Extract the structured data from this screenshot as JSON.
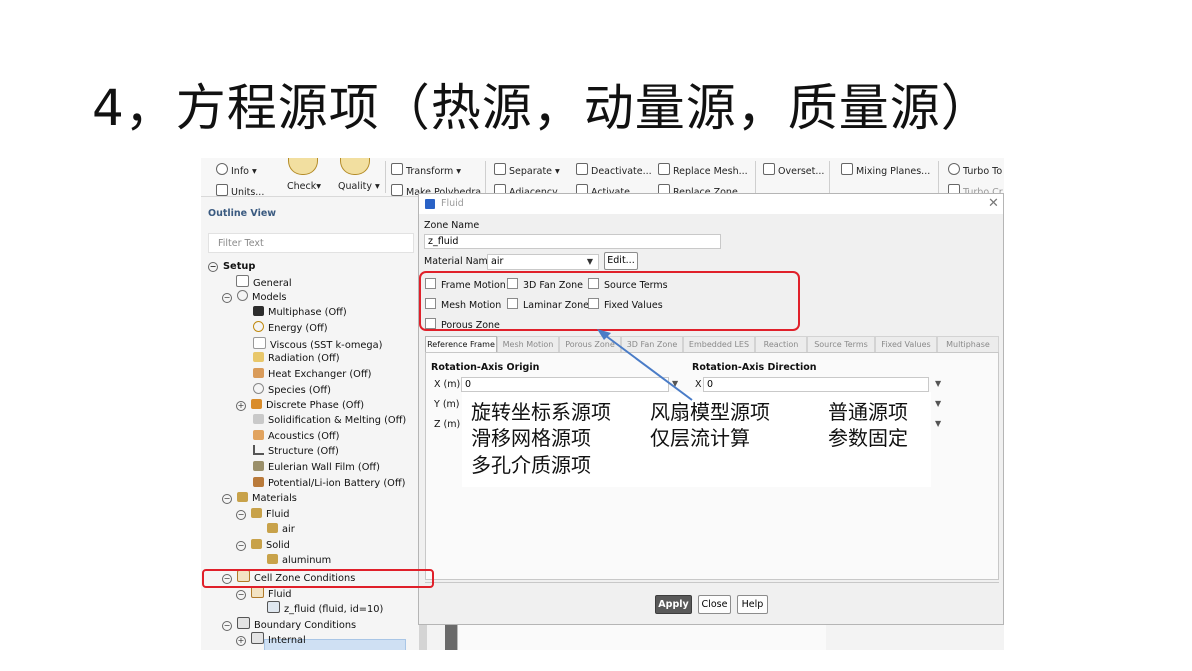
{
  "slide": {
    "title": "4，方程源项（热源，动量源，质量源）"
  },
  "ribbon": {
    "info": "Info",
    "units": "Units...",
    "check": "Check",
    "quality": "Quality",
    "transform": "Transform",
    "make_polyhedra": "Make Polyhedra",
    "separate": "Separate",
    "adjacency": "Adjacency...",
    "deactivate": "Deactivate...",
    "activate": "Activate...",
    "replace_mesh": "Replace Mesh...",
    "replace_zone": "Replace Zone...",
    "overset": "Overset...",
    "mixing_planes": "Mixing Planes...",
    "turbo_to": "Turbo To",
    "turbo_cr": "Turbo Cr"
  },
  "outline": {
    "title": "Outline View",
    "filter_placeholder": "Filter Text",
    "items": {
      "setup": "Setup",
      "general": "General",
      "models": "Models",
      "multiphase": "Multiphase (Off)",
      "energy": "Energy (Off)",
      "viscous": "Viscous (SST k-omega)",
      "radiation": "Radiation (Off)",
      "heat_exchanger": "Heat Exchanger (Off)",
      "species": "Species (Off)",
      "discrete_phase": "Discrete Phase (Off)",
      "solidification": "Solidification & Melting (Off)",
      "acoustics": "Acoustics (Off)",
      "structure": "Structure (Off)",
      "eulerian_wall_film": "Eulerian Wall Film (Off)",
      "potential_battery": "Potential/Li-ion Battery (Off)",
      "materials": "Materials",
      "fluid_group": "Fluid",
      "air": "air",
      "solid_group": "Solid",
      "aluminum": "aluminum",
      "cell_zone_conditions": "Cell Zone Conditions",
      "cz_fluid": "Fluid",
      "z_fluid": "z_fluid (fluid, id=10)",
      "boundary_conditions": "Boundary Conditions",
      "internal": "Internal"
    }
  },
  "dialog": {
    "title": "Fluid",
    "zone_name_label": "Zone Name",
    "zone_name_value": "z_fluid",
    "material_name_label": "Material Name",
    "material_value": "air",
    "edit_button": "Edit...",
    "options": {
      "frame_motion": "Frame Motion",
      "fan_zone": "3D Fan Zone",
      "source_terms": "Source Terms",
      "mesh_motion": "Mesh Motion",
      "laminar_zone": "Laminar Zone",
      "fixed_values": "Fixed Values",
      "porous_zone": "Porous Zone"
    },
    "tabs": [
      "Reference Frame",
      "Mesh Motion",
      "Porous Zone",
      "3D Fan Zone",
      "Embedded LES",
      "Reaction",
      "Source Terms",
      "Fixed Values",
      "Multiphase"
    ],
    "origin_title": "Rotation-Axis Origin",
    "direction_title": "Rotation-Axis Direction",
    "x_label": "X (m)",
    "y_label": "Y (m)",
    "z_label": "Z (m)",
    "x_value": "0",
    "dir_x_label": "X",
    "dir_x_value": "0",
    "apply": "Apply",
    "close": "Close",
    "help": "Help"
  },
  "callout": {
    "col1": [
      "旋转坐标系源项",
      "滑移网格源项",
      "多孔介质源项"
    ],
    "col2": [
      "风扇模型源项",
      "仅层流计算"
    ],
    "col3": [
      "普通源项",
      "参数固定"
    ]
  },
  "colors": {
    "highlight": "#e0202a",
    "arrow": "#4a7cc7",
    "apply": "#595959"
  }
}
